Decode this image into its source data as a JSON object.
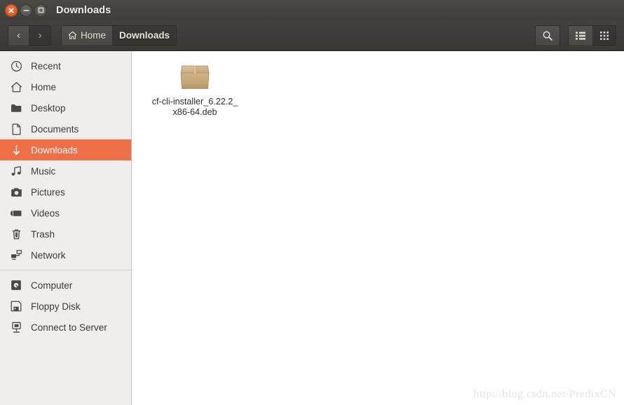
{
  "window": {
    "title": "Downloads",
    "controls": [
      {
        "name": "close",
        "glyph": "×"
      },
      {
        "name": "minimize",
        "glyph": "−"
      },
      {
        "name": "maximize",
        "glyph": "□"
      }
    ]
  },
  "toolbar": {
    "back_label": "‹",
    "forward_label": "›",
    "breadcrumbs": [
      {
        "label": "Home",
        "icon": "home-icon",
        "active": false
      },
      {
        "label": "Downloads",
        "icon": "",
        "active": true
      }
    ],
    "search_icon": "search-icon",
    "list_view_icon": "list-view-icon",
    "grid_view_icon": "grid-view-icon",
    "active_view": "grid"
  },
  "sidebar": {
    "groups": [
      {
        "items": [
          {
            "label": "Recent",
            "icon": "clock-icon",
            "selected": false
          },
          {
            "label": "Home",
            "icon": "home-icon",
            "selected": false
          },
          {
            "label": "Desktop",
            "icon": "folder-icon",
            "selected": false
          },
          {
            "label": "Documents",
            "icon": "document-icon",
            "selected": false
          },
          {
            "label": "Downloads",
            "icon": "download-icon",
            "selected": true
          },
          {
            "label": "Music",
            "icon": "music-icon",
            "selected": false
          },
          {
            "label": "Pictures",
            "icon": "camera-icon",
            "selected": false
          },
          {
            "label": "Videos",
            "icon": "video-icon",
            "selected": false
          },
          {
            "label": "Trash",
            "icon": "trash-icon",
            "selected": false
          },
          {
            "label": "Network",
            "icon": "network-icon",
            "selected": false
          }
        ]
      },
      {
        "items": [
          {
            "label": "Computer",
            "icon": "harddisk-icon",
            "selected": false
          },
          {
            "label": "Floppy Disk",
            "icon": "floppy-icon",
            "selected": false
          },
          {
            "label": "Connect to Server",
            "icon": "server-icon",
            "selected": false
          }
        ]
      }
    ]
  },
  "content": {
    "files": [
      {
        "name": "cf-cli-installer_6.22.2_x86-64.deb",
        "icon": "package-box-icon"
      }
    ]
  },
  "watermark": {
    "text": "http://blog.csdn.net/PredixCN"
  },
  "colors": {
    "accent": "#ef7047",
    "titlebar": "#444340",
    "sidebar": "#efeeec",
    "close_button": "#e2551e",
    "package_box": "#c9ac7d"
  }
}
